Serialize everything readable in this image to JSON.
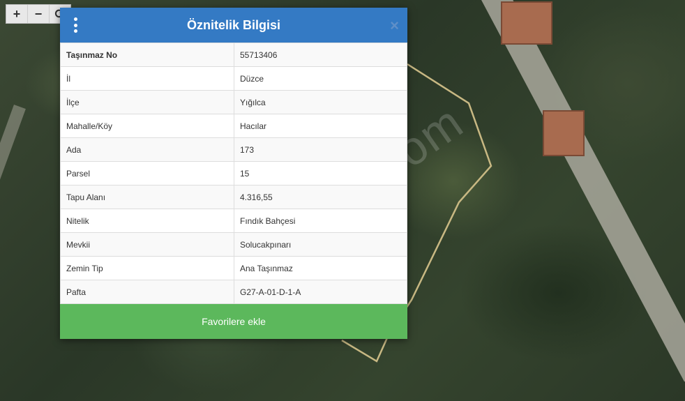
{
  "map": {
    "controls": [
      "+",
      "−",
      "⟳"
    ],
    "watermark": "emlakjet.com"
  },
  "dialog": {
    "title": "Öznitelik Bilgisi",
    "close_label": "×",
    "rows": [
      {
        "key": "Taşınmaz No",
        "value": "55713406"
      },
      {
        "key": "İl",
        "value": "Düzce"
      },
      {
        "key": "İlçe",
        "value": "Yığılca"
      },
      {
        "key": "Mahalle/Köy",
        "value": "Hacılar"
      },
      {
        "key": "Ada",
        "value": "173"
      },
      {
        "key": "Parsel",
        "value": "15"
      },
      {
        "key": "Tapu Alanı",
        "value": "4.316,55"
      },
      {
        "key": "Nitelik",
        "value": "Fındık Bahçesi"
      },
      {
        "key": "Mevkii",
        "value": "Solucakpınarı"
      },
      {
        "key": "Zemin Tip",
        "value": "Ana Taşınmaz"
      },
      {
        "key": "Pafta",
        "value": "G27-A-01-D-1-A"
      }
    ],
    "favorite_button": "Favorilere ekle"
  },
  "colors": {
    "header": "#347ac4",
    "button": "#5cb85c",
    "parcel_outline": "#c8b883"
  }
}
